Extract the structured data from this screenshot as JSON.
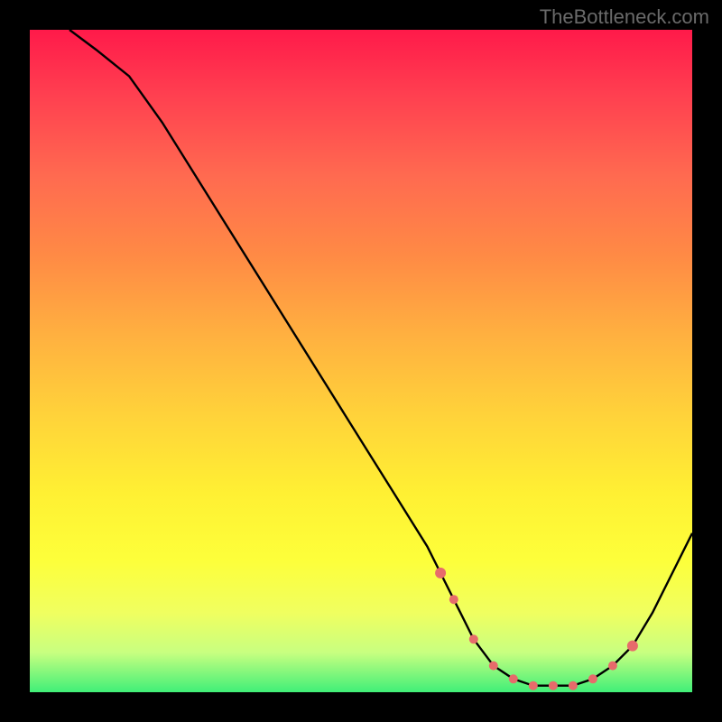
{
  "attribution": "TheBottleneck.com",
  "chart_data": {
    "type": "line",
    "title": "",
    "xlabel": "",
    "ylabel": "",
    "xlim": [
      0,
      100
    ],
    "ylim": [
      0,
      100
    ],
    "background_gradient": {
      "top": "#ff1a4a",
      "bottom": "#40ef78",
      "meaning": "red high = bottleneck, green low = balanced"
    },
    "series": [
      {
        "name": "bottleneck-curve",
        "color": "#000000",
        "x": [
          6,
          10,
          15,
          20,
          25,
          30,
          35,
          40,
          45,
          50,
          55,
          60,
          62,
          64,
          67,
          70,
          73,
          76,
          79,
          82,
          85,
          88,
          91,
          94,
          97,
          100
        ],
        "y": [
          100,
          97,
          93,
          86,
          78,
          70,
          62,
          54,
          46,
          38,
          30,
          22,
          18,
          14,
          8,
          4,
          2,
          1,
          1,
          1,
          2,
          4,
          7,
          12,
          18,
          24
        ]
      }
    ],
    "markers": {
      "name": "highlighted-range",
      "color": "#e76b6b",
      "x": [
        62,
        64,
        67,
        70,
        73,
        76,
        79,
        82,
        85,
        88,
        91
      ],
      "y": [
        18,
        14,
        8,
        4,
        2,
        1,
        1,
        1,
        2,
        4,
        7
      ]
    }
  }
}
